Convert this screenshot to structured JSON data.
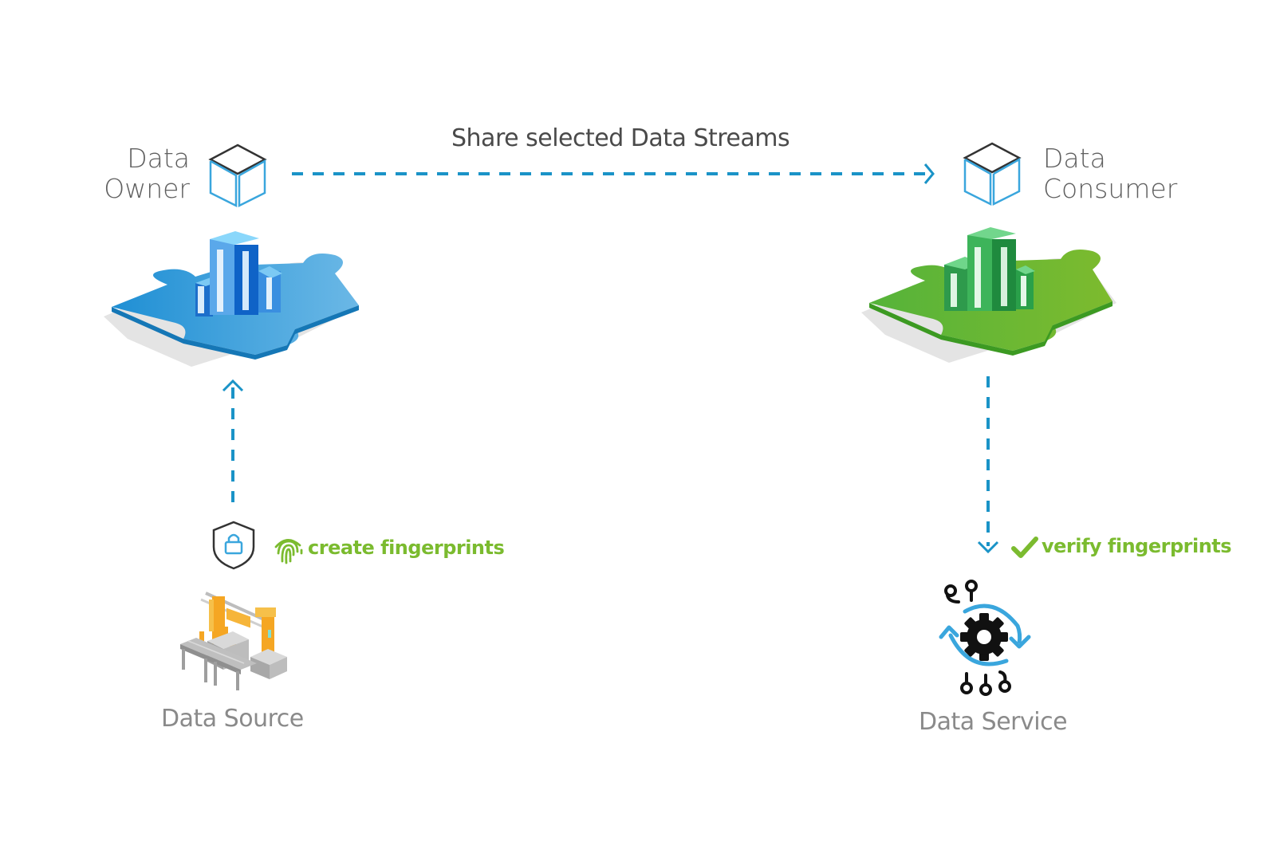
{
  "diagram": {
    "nodes": {
      "owner": {
        "label_line1": "Data",
        "label_line2": "Owner",
        "icon": "cube-icon",
        "platform_color": "#2a9ad8"
      },
      "consumer": {
        "label_line1": "Data",
        "label_line2": "Consumer",
        "icon": "cube-icon",
        "platform_color": "#5cb833"
      },
      "source": {
        "label": "Data Source",
        "icon": "factory-robot-arm-icon"
      },
      "service": {
        "label": "Data Service",
        "icon": "gear-cycle-icon"
      }
    },
    "edges": {
      "owner_to_consumer": {
        "label": "Share selected Data Streams",
        "style": "dashed"
      },
      "source_to_owner": {
        "style": "dashed"
      },
      "consumer_to_service": {
        "style": "dashed"
      }
    },
    "annotations": {
      "create": {
        "text": "create fingerprints",
        "icon": "fingerprint-icon"
      },
      "verify": {
        "text": "verify fingerprints",
        "icon": "checkmark-icon"
      },
      "security": {
        "icon": "shield-lock-icon"
      }
    },
    "colors": {
      "arrow": "#1a93c7",
      "accent_green": "#7bbb2f",
      "cube_outline": "#3aa6dd",
      "cube_top": "#333333",
      "text_gray": "#5f5f5f"
    }
  }
}
